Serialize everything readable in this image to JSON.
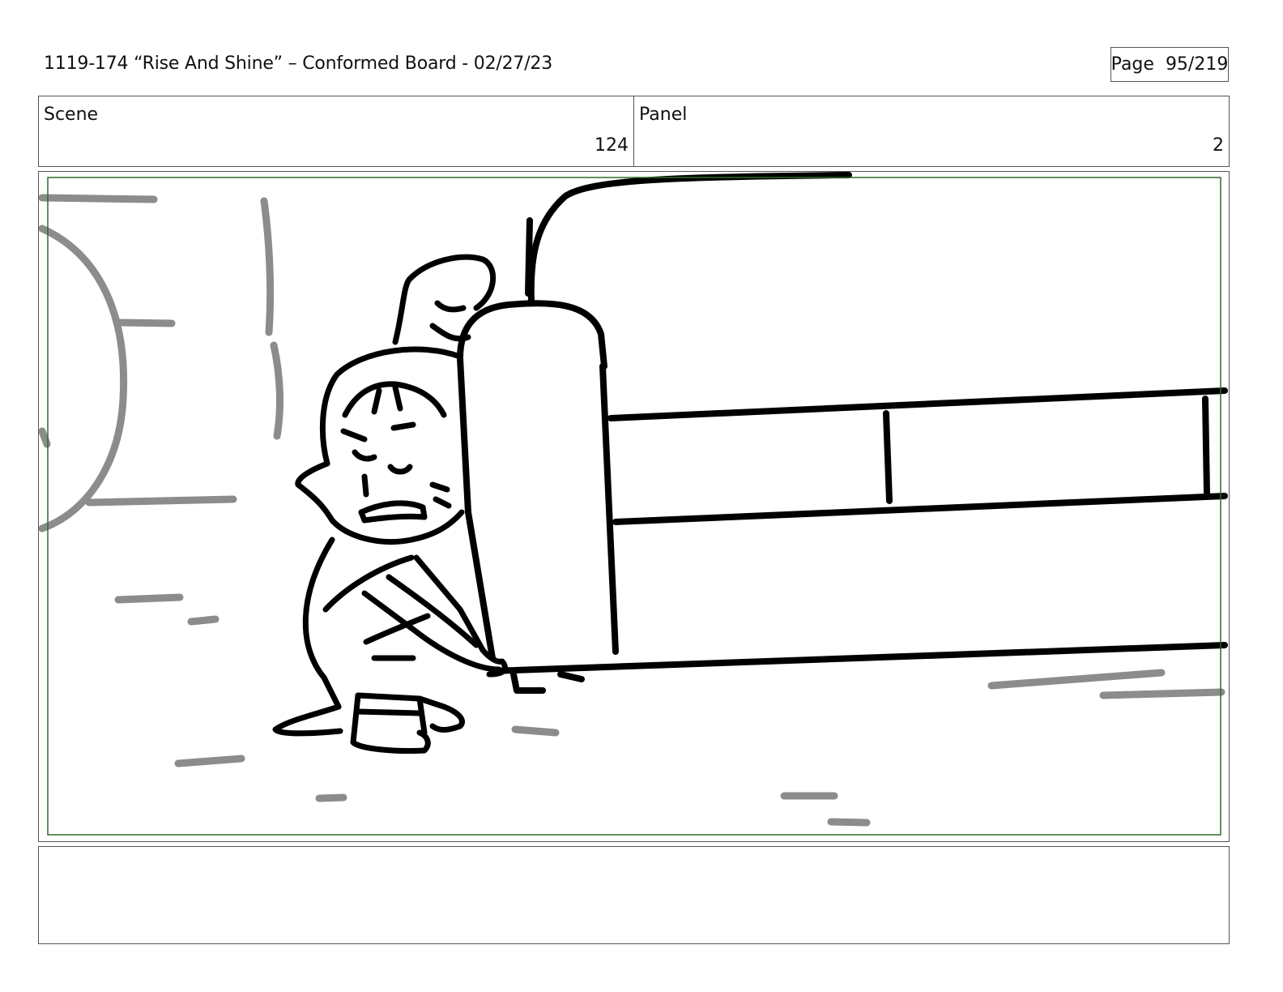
{
  "header": {
    "title": "1119-174 “Rise And Shine” – Conformed Board - 02/27/23",
    "page_label": "Page",
    "page_number": "95/219"
  },
  "scene": {
    "label": "Scene",
    "value": "124"
  },
  "panel": {
    "label": "Panel",
    "value": "2"
  },
  "drawing": {
    "description_icon": "storyboard-sketch",
    "safe_frame_color": "#2e6b2e",
    "ink_color": "#000000",
    "background_line_color": "#8c8c8c"
  },
  "notes": {
    "text": ""
  }
}
